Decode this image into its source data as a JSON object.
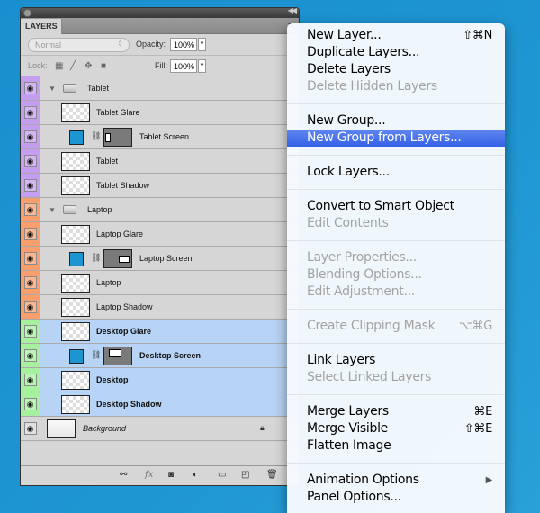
{
  "panel": {
    "tab_label": "LAYERS",
    "blend_mode": "Normal",
    "opacity_label": "Opacity:",
    "opacity_value": "100%",
    "lock_label": "Lock:",
    "fill_label": "Fill:",
    "fill_value": "100%"
  },
  "layers": [
    {
      "name": "Tablet",
      "type": "group",
      "color": "purple",
      "selected": false
    },
    {
      "name": "Tablet Glare",
      "type": "layer",
      "color": "purple",
      "selected": false
    },
    {
      "name": "Tablet Screen",
      "type": "fill-mask",
      "color": "purple",
      "selected": false
    },
    {
      "name": "Tablet",
      "type": "layer",
      "color": "purple",
      "selected": false
    },
    {
      "name": "Tablet Shadow",
      "type": "layer",
      "color": "purple",
      "selected": false
    },
    {
      "name": "Laptop",
      "type": "group",
      "color": "orange",
      "selected": false
    },
    {
      "name": "Laptop Glare",
      "type": "layer",
      "color": "orange",
      "selected": false
    },
    {
      "name": "Laptop Screen",
      "type": "fill-mask",
      "color": "orange",
      "selected": false
    },
    {
      "name": "Laptop",
      "type": "layer",
      "color": "orange",
      "selected": false
    },
    {
      "name": "Laptop Shadow",
      "type": "layer",
      "color": "orange",
      "selected": false
    },
    {
      "name": "Desktop Glare",
      "type": "layer",
      "color": "green",
      "selected": true
    },
    {
      "name": "Desktop Screen",
      "type": "fill-mask",
      "color": "green",
      "selected": true
    },
    {
      "name": "Desktop",
      "type": "layer",
      "color": "green",
      "selected": true
    },
    {
      "name": "Desktop Shadow",
      "type": "layer",
      "color": "green",
      "selected": true
    },
    {
      "name": "Background",
      "type": "background",
      "color": "none",
      "selected": false
    }
  ],
  "colors": {
    "purple": "#c59df1",
    "orange": "#f99f6e",
    "green": "#a6f09f",
    "selection": "#b7d3f5",
    "highlight": "#3a67e8",
    "swatch": "#1d95d0"
  },
  "menu": {
    "items": [
      {
        "label": "New Layer...",
        "shortcut": "⇧⌘N",
        "disabled": false
      },
      {
        "label": "Duplicate Layers...",
        "disabled": false
      },
      {
        "label": "Delete Layers",
        "disabled": false
      },
      {
        "label": "Delete Hidden Layers",
        "disabled": true
      },
      {
        "label": "New Group...",
        "disabled": false
      },
      {
        "label": "New Group from Layers...",
        "disabled": false,
        "highlighted": true
      },
      {
        "label": "Lock Layers...",
        "disabled": false
      },
      {
        "label": "Convert to Smart Object",
        "disabled": false
      },
      {
        "label": "Edit Contents",
        "disabled": true
      },
      {
        "label": "Layer Properties...",
        "disabled": true
      },
      {
        "label": "Blending Options...",
        "disabled": true
      },
      {
        "label": "Edit Adjustment...",
        "disabled": true
      },
      {
        "label": "Create Clipping Mask",
        "shortcut": "⌥⌘G",
        "disabled": true
      },
      {
        "label": "Link Layers",
        "disabled": false
      },
      {
        "label": "Select Linked Layers",
        "disabled": true
      },
      {
        "label": "Merge Layers",
        "shortcut": "⌘E",
        "disabled": false
      },
      {
        "label": "Merge Visible",
        "shortcut": "⇧⌘E",
        "disabled": false
      },
      {
        "label": "Flatten Image",
        "disabled": false
      },
      {
        "label": "Animation Options",
        "shortcut": "▶",
        "disabled": false
      },
      {
        "label": "Panel Options...",
        "disabled": false
      }
    ]
  }
}
